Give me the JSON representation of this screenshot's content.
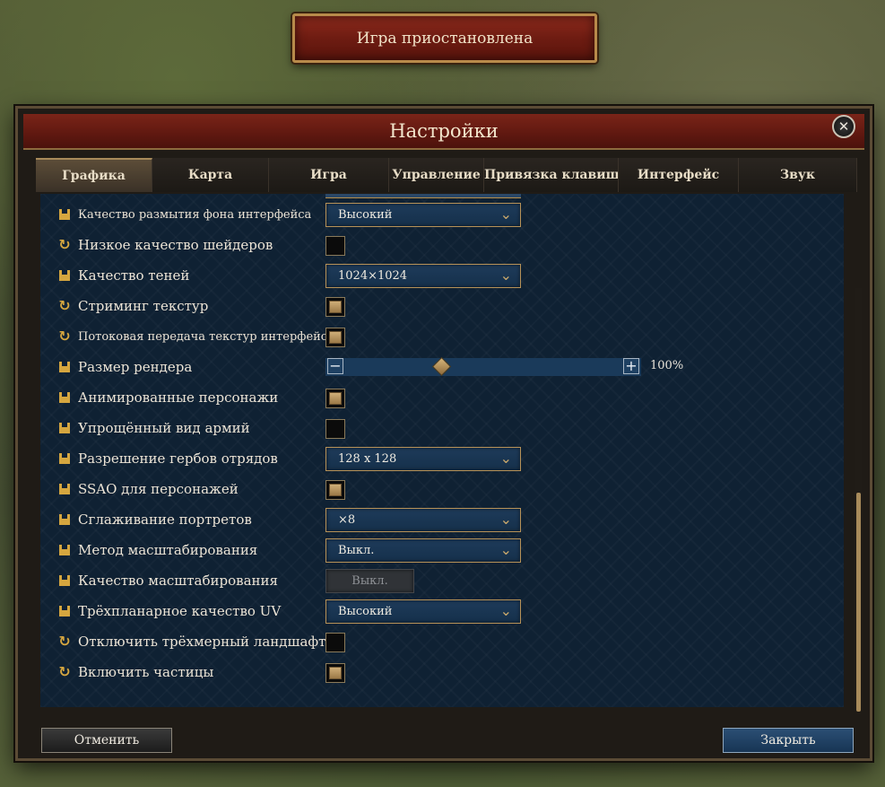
{
  "banner": {
    "paused_text": "Игра приостановлена"
  },
  "window": {
    "title": "Настройки",
    "close_glyph": "✕"
  },
  "tabs": [
    {
      "label": "Графика",
      "active": true
    },
    {
      "label": "Карта"
    },
    {
      "label": "Игра"
    },
    {
      "label": "Управление"
    },
    {
      "label": "Привязка клавиш вво"
    },
    {
      "label": "Интерфейс"
    },
    {
      "label": "Звук"
    }
  ],
  "settings": [
    {
      "icon": "save-icon",
      "label": "Качество размытия фона интерфейса",
      "control": "dropdown",
      "value": "Высокий",
      "small": true
    },
    {
      "icon": "refresh-icon",
      "label": "Низкое качество шейдеров",
      "control": "checkbox",
      "checked": false
    },
    {
      "icon": "save-icon",
      "label": "Качество теней",
      "control": "dropdown",
      "value": "1024×1024"
    },
    {
      "icon": "refresh-icon",
      "label": "Стриминг текстур",
      "control": "checkbox",
      "checked": true
    },
    {
      "icon": "refresh-icon",
      "label": "Потоковая передача текстур интерфейса",
      "control": "checkbox",
      "checked": true,
      "small": true
    },
    {
      "icon": "save-icon",
      "label": "Размер рендера",
      "control": "slider",
      "value": "100%",
      "fraction": 0.33
    },
    {
      "icon": "save-icon",
      "label": "Анимированные персонажи",
      "control": "checkbox",
      "checked": true
    },
    {
      "icon": "save-icon",
      "label": "Упрощённый вид армий",
      "control": "checkbox",
      "checked": false
    },
    {
      "icon": "save-icon",
      "label": "Разрешение гербов отрядов",
      "control": "dropdown",
      "value": "128 x 128"
    },
    {
      "icon": "save-icon",
      "label": "SSAO для персонажей",
      "control": "checkbox",
      "checked": true
    },
    {
      "icon": "save-icon",
      "label": "Сглаживание портретов",
      "control": "dropdown",
      "value": "×8"
    },
    {
      "icon": "save-icon",
      "label": "Метод масштабирования",
      "control": "dropdown",
      "value": "Выкл."
    },
    {
      "icon": "save-icon",
      "label": "Качество масштабирования",
      "control": "dropdown-disabled",
      "value": "Выкл."
    },
    {
      "icon": "save-icon",
      "label": "Трёхпланарное качество UV",
      "control": "dropdown",
      "value": "Высокий"
    },
    {
      "icon": "refresh-icon",
      "label": "Отключить трёхмерный ландшафт",
      "control": "checkbox",
      "checked": false
    },
    {
      "icon": "refresh-icon",
      "label": "Включить частицы",
      "control": "checkbox",
      "checked": true
    }
  ],
  "slider_buttons": {
    "minus": "−",
    "plus": "+"
  },
  "chevron_glyph": "⌄",
  "footer": {
    "cancel_label": "Отменить",
    "close_label": "Закрыть"
  }
}
